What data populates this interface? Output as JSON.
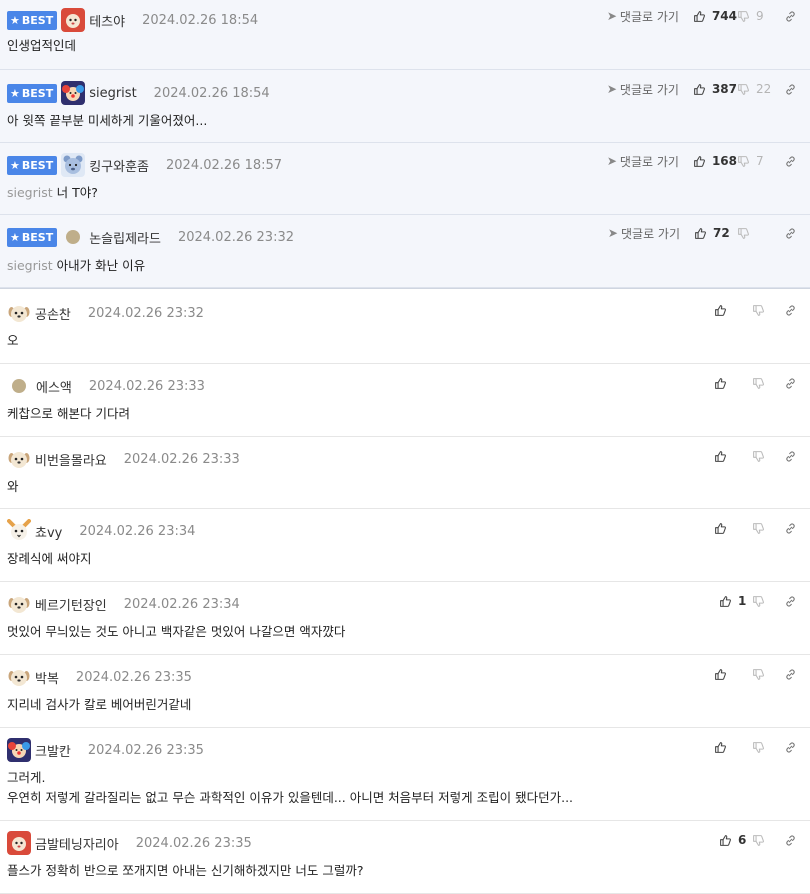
{
  "labels": {
    "best": "BEST",
    "goto_reply": "댓글로 가기"
  },
  "colors": {
    "accent": "#4a86e8",
    "best_bg": "#f4f6fb"
  },
  "comments": [
    {
      "best": true,
      "avatar": "red-hood-avatar",
      "nickname": "테츠야",
      "date": "2024.02.26 18:54",
      "mention": "",
      "text": "인생업적인데",
      "upvotes": "744",
      "downvotes": "9"
    },
    {
      "best": true,
      "avatar": "clown-avatar",
      "nickname": "siegrist",
      "date": "2024.02.26 18:54",
      "mention": "",
      "text": "아 윗쪽 끝부분 미세하게 기울어졌어...",
      "upvotes": "387",
      "downvotes": "22"
    },
    {
      "best": true,
      "avatar": "blue-bear-avatar",
      "nickname": "킹구와훈좀",
      "date": "2024.02.26 18:57",
      "mention": "siegrist",
      "text": "너 T야?",
      "upvotes": "168",
      "downvotes": "7"
    },
    {
      "best": true,
      "avatar": "dot-avatar",
      "nickname": "논슬립제라드",
      "date": "2024.02.26 23:32",
      "mention": "siegrist",
      "text": "아내가 화난 이유",
      "upvotes": "72",
      "downvotes": ""
    },
    {
      "best": false,
      "avatar": "dog-avatar",
      "nickname": "공손찬",
      "date": "2024.02.26 23:32",
      "mention": "",
      "text": "오",
      "upvotes": "",
      "downvotes": ""
    },
    {
      "best": false,
      "avatar": "dot-avatar",
      "nickname": "에스액",
      "date": "2024.02.26 23:33",
      "mention": "",
      "text": "케찹으로 해본다 기다려",
      "upvotes": "",
      "downvotes": ""
    },
    {
      "best": false,
      "avatar": "dog-avatar",
      "nickname": "비번을몰라요",
      "date": "2024.02.26 23:33",
      "mention": "",
      "text": "와",
      "upvotes": "",
      "downvotes": ""
    },
    {
      "best": false,
      "avatar": "fox-avatar",
      "nickname": "쵸vy",
      "date": "2024.02.26 23:34",
      "mention": "",
      "text": "장례식에 써야지",
      "upvotes": "",
      "downvotes": ""
    },
    {
      "best": false,
      "avatar": "dog-avatar",
      "nickname": "베르기턴장인",
      "date": "2024.02.26 23:34",
      "mention": "",
      "text": "멋있어 무늬있는 것도 아니고 백자같은 멋있어 나갈으면 액자꺘다",
      "upvotes": "1",
      "downvotes": ""
    },
    {
      "best": false,
      "avatar": "dog-avatar",
      "nickname": "박복",
      "date": "2024.02.26 23:35",
      "mention": "",
      "text": "지리네 검사가 칼로 베어버린거같네",
      "upvotes": "",
      "downvotes": ""
    },
    {
      "best": false,
      "avatar": "clown-avatar",
      "nickname": "크발칸",
      "date": "2024.02.26 23:35",
      "mention": "",
      "text": "그러게.",
      "text2": "우연히 저렇게 갈라질리는 없고 무슨 과학적인 이유가 있을텐데... 아니면 처음부터 저렇게 조립이 됐다던가...",
      "upvotes": "",
      "downvotes": ""
    },
    {
      "best": false,
      "avatar": "red-hood-avatar",
      "nickname": "금발테닝자리아",
      "date": "2024.02.26 23:35",
      "mention": "",
      "text": "플스가 정확히 반으로 쪼개지면 아내는 신기해하겠지만 너도 그럴까?",
      "upvotes": "6",
      "downvotes": ""
    }
  ]
}
